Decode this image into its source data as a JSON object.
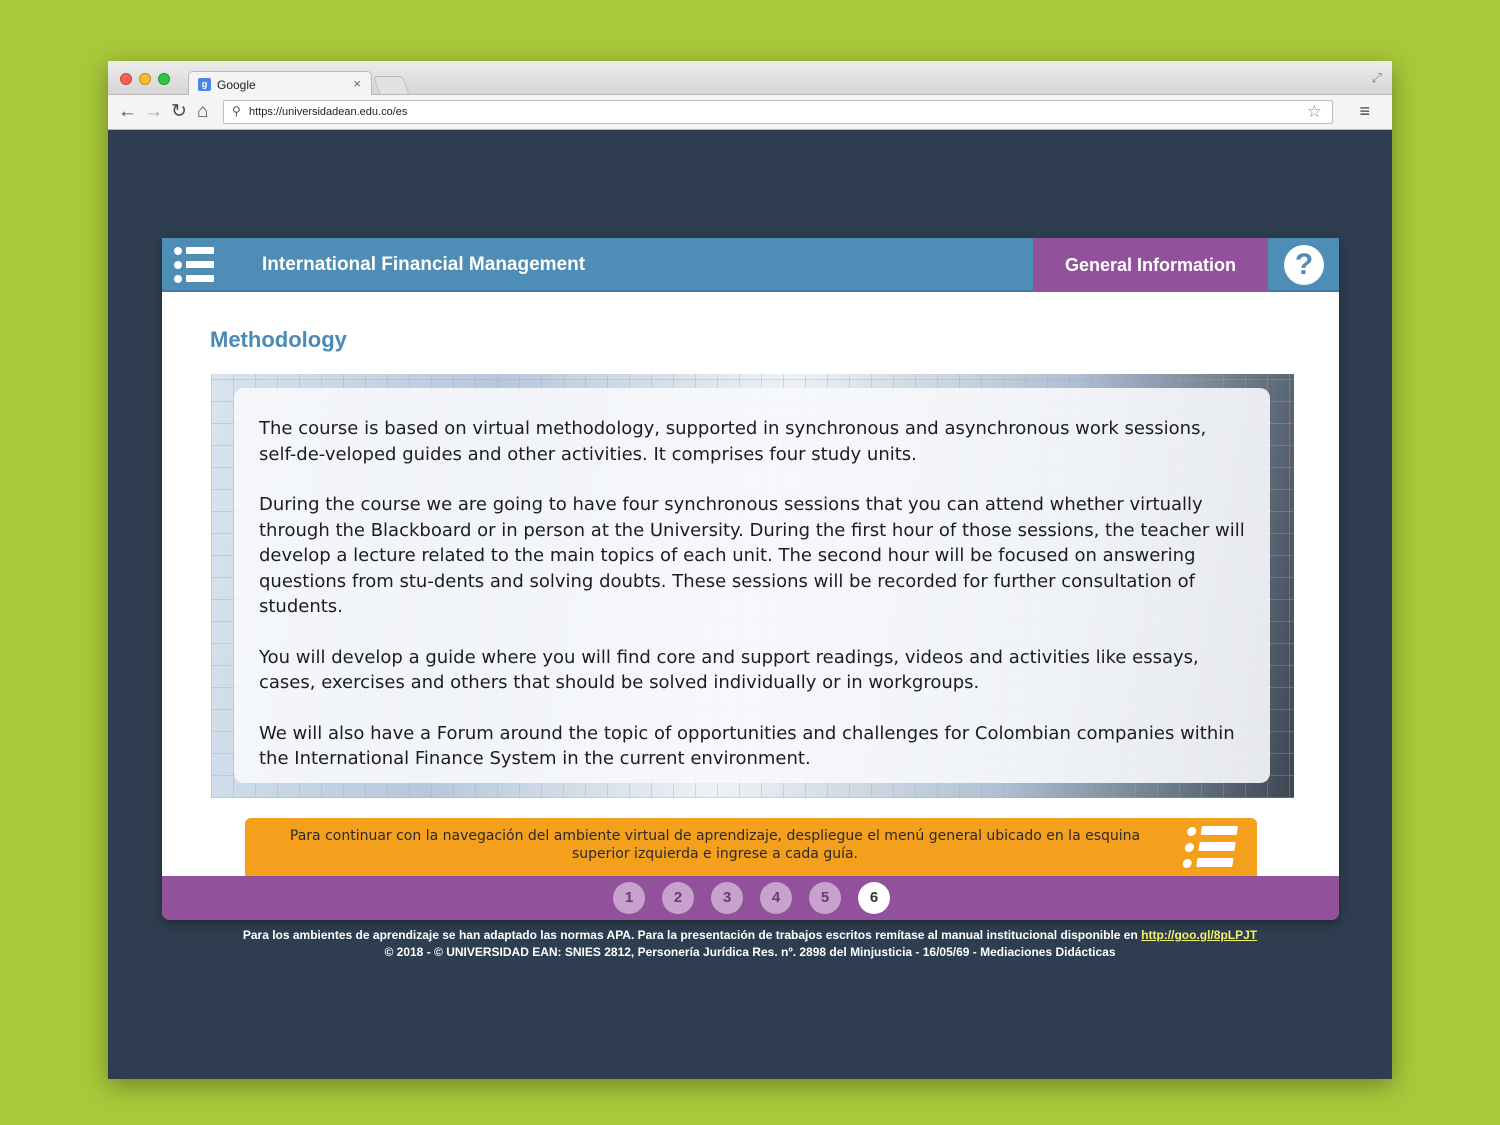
{
  "browser": {
    "tab_title": "Google",
    "tab_close": "×",
    "url": "https://universidadean.edu.co/es"
  },
  "header": {
    "course_title": "International Financial Management",
    "general_info_label": "General Information",
    "help_label": "?"
  },
  "main": {
    "section_title": "Methodology",
    "paragraphs": [
      "The course is based on virtual methodology, supported in synchronous and asynchronous work sessions, self-de-veloped guides and other activities. It comprises four study units.",
      "During the course we are going to have four synchronous sessions that you can attend whether virtually through the Blackboard or in person at the University. During the first hour of those sessions, the teacher will develop a lecture related to the main topics of each unit. The second hour will be focused on answering questions from stu-dents and solving doubts. These sessions will be recorded for further consultation of students.",
      "You will develop a guide where you will find core and support readings, videos and activities like essays, cases, exercises and others that should be solved individually or in workgroups.",
      "We will also have a Forum around the topic of opportunities and challenges for Colombian companies within the International Finance System in the current environment."
    ]
  },
  "notice": {
    "text": "Para continuar con la navegación del ambiente virtual de aprendizaje, despliegue el menú general ubicado en la esquina superior izquierda e ingrese a cada guía."
  },
  "pager": {
    "pages": [
      "1",
      "2",
      "3",
      "4",
      "5",
      "6"
    ],
    "current": "6"
  },
  "footer": {
    "line1": "Para los ambientes de aprendizaje se han adaptado las normas APA. Para la presentación de trabajos escritos remítase al manual institucional disponible en",
    "link": "http://goo.gl/8pLPJT",
    "line2": "© 2018 - © UNIVERSIDAD EAN: SNIES 2812, Personería Jurídica Res. nº. 2898 del Minjusticia - 16/05/69 - Mediaciones Didácticas"
  },
  "colors": {
    "page_background": "#a9c93b",
    "header_blue": "#4e8db6",
    "accent_purple": "#92519b",
    "notice_orange": "#f5a01d"
  },
  "icons": [
    "menu-list-icon",
    "help-icon",
    "back-arrow-icon",
    "forward-arrow-icon",
    "reload-icon",
    "home-icon",
    "search-icon",
    "star-icon",
    "hamburger-icon"
  ]
}
